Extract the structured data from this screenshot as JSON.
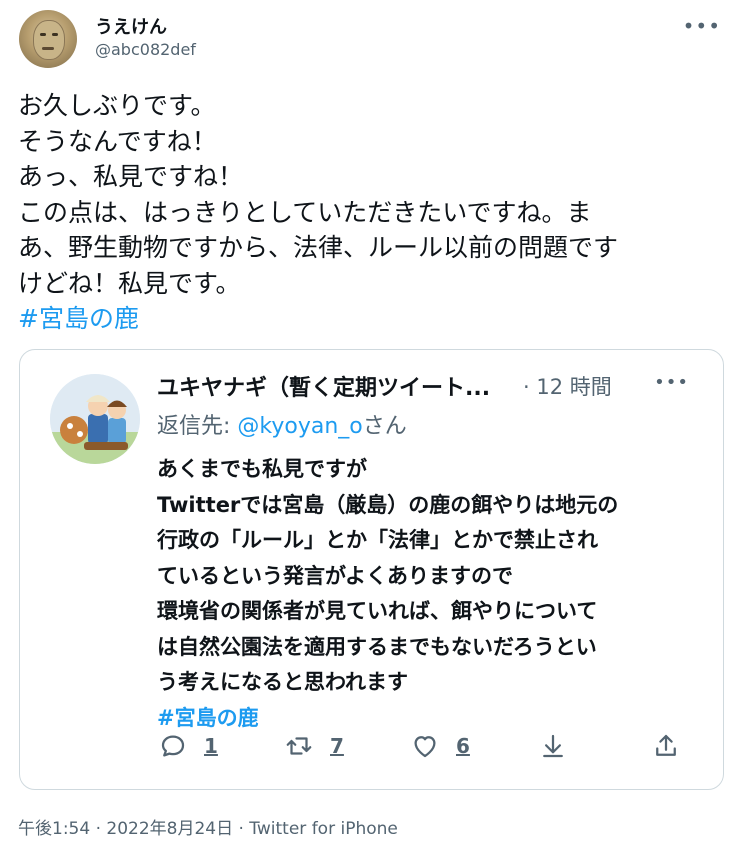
{
  "tweet": {
    "author": {
      "display_name": "うえけん",
      "handle": "@abc082def"
    },
    "more_label": "•••",
    "text_lines": [
      "お久しぶりです。",
      "そうなんですね！",
      "あっ、私見ですね！",
      "この点は、はっきりとしていただきたいですね。ま",
      "あ、野生動物ですから、法律、ルール以前の問題です",
      "けどね！私見です。"
    ],
    "hashtag": "#宮島の鹿",
    "meta": "午後1:54 · 2022年8月24日 · Twitter for iPhone"
  },
  "quoted_tweet": {
    "author_name": "ユキヤナギ（暫く定期ツイート...",
    "time": "· 12 時間",
    "more_label": "•••",
    "reply_prefix": "返信先: ",
    "reply_mention": "@kyoyan_o",
    "reply_suffix": "さん",
    "body_lines": [
      "あくまでも私見ですが",
      "Twitterでは宮島（厳島）の鹿の餌やりは地元の",
      "行政の「ルール」とか「法律」とかで禁止され",
      "ているという発言がよくありますので",
      "環境省の関係者が見ていれば、餌やりについて",
      "は自然公園法を適用するまでもないだろうとい",
      "う考えになると思われます"
    ],
    "hashtag": "#宮島の鹿",
    "actions": {
      "reply_count": "1",
      "retweet_count": "7",
      "like_count": "6"
    }
  },
  "colors": {
    "accent": "#1d9bf0",
    "muted": "#536471",
    "border": "#cfd9de"
  }
}
